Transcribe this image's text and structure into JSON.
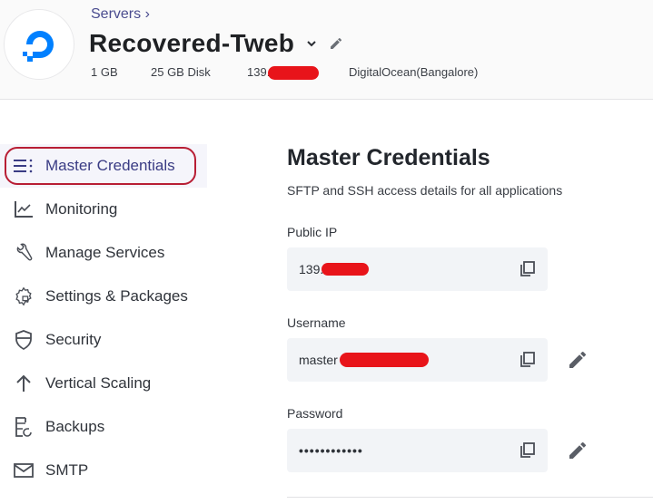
{
  "header": {
    "breadcrumb": "Servers ›",
    "server_name": "Recovered-Tweb",
    "ram": "1 GB",
    "disk": "25 GB Disk",
    "ip_prefix": "139.",
    "provider": "DigitalOcean(Bangalore)",
    "logo": "digitalocean-logo",
    "brand_color": "#0080ff"
  },
  "sidebar": {
    "items": [
      {
        "label": "Master Credentials",
        "icon": "list-icon",
        "active": true
      },
      {
        "label": "Monitoring",
        "icon": "chart-line-icon"
      },
      {
        "label": "Manage Services",
        "icon": "wrench-icon"
      },
      {
        "label": "Settings & Packages",
        "icon": "gear-icon"
      },
      {
        "label": "Security",
        "icon": "shield-icon"
      },
      {
        "label": "Vertical Scaling",
        "icon": "arrow-up-icon"
      },
      {
        "label": "Backups",
        "icon": "backup-icon"
      },
      {
        "label": "SMTP",
        "icon": "mail-icon"
      }
    ],
    "active_color": "#3a3c84",
    "annotation_color": "#b81e34"
  },
  "main": {
    "title": "Master Credentials",
    "subtitle": "SFTP and SSH access details for all applications",
    "fields": [
      {
        "label": "Public IP",
        "value": "139.",
        "redacted": true,
        "copy": true,
        "edit": false
      },
      {
        "label": "Username",
        "value": "master",
        "redacted": true,
        "copy": true,
        "edit": true
      },
      {
        "label": "Password",
        "value": "••••••••••••",
        "redacted": false,
        "copy": true,
        "edit": true
      }
    ]
  }
}
